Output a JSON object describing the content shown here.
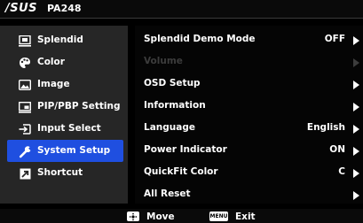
{
  "header": {
    "brand": "/SUS",
    "model": "PA248"
  },
  "sidebar": {
    "items": [
      {
        "label": "Splendid",
        "icon": "splendid-icon"
      },
      {
        "label": "Color",
        "icon": "palette-icon"
      },
      {
        "label": "Image",
        "icon": "image-icon"
      },
      {
        "label": "PIP/PBP Setting",
        "icon": "pip-icon"
      },
      {
        "label": "Input Select",
        "icon": "input-icon"
      },
      {
        "label": "System Setup",
        "icon": "wrench-icon",
        "selected": true
      },
      {
        "label": "Shortcut",
        "icon": "shortcut-icon"
      }
    ]
  },
  "main": {
    "rows": [
      {
        "label": "Splendid Demo Mode",
        "value": "OFF",
        "enabled": true
      },
      {
        "label": "Volume",
        "value": "",
        "enabled": false
      },
      {
        "label": "OSD Setup",
        "value": "",
        "enabled": true
      },
      {
        "label": "Information",
        "value": "",
        "enabled": true
      },
      {
        "label": "Language",
        "value": "English",
        "enabled": true
      },
      {
        "label": "Power Indicator",
        "value": "ON",
        "enabled": true
      },
      {
        "label": "QuickFit Color",
        "value": "C",
        "enabled": true
      },
      {
        "label": "All Reset",
        "value": "",
        "enabled": true
      }
    ]
  },
  "footer": {
    "move_key": "joystick",
    "move_label": "Move",
    "exit_key": "MENU",
    "exit_label": "Exit"
  },
  "colors": {
    "selected": "#1f4fe0",
    "sidebar_bg": "#262626",
    "main_bg": "#050505",
    "disabled_text": "#3c3c3c"
  }
}
